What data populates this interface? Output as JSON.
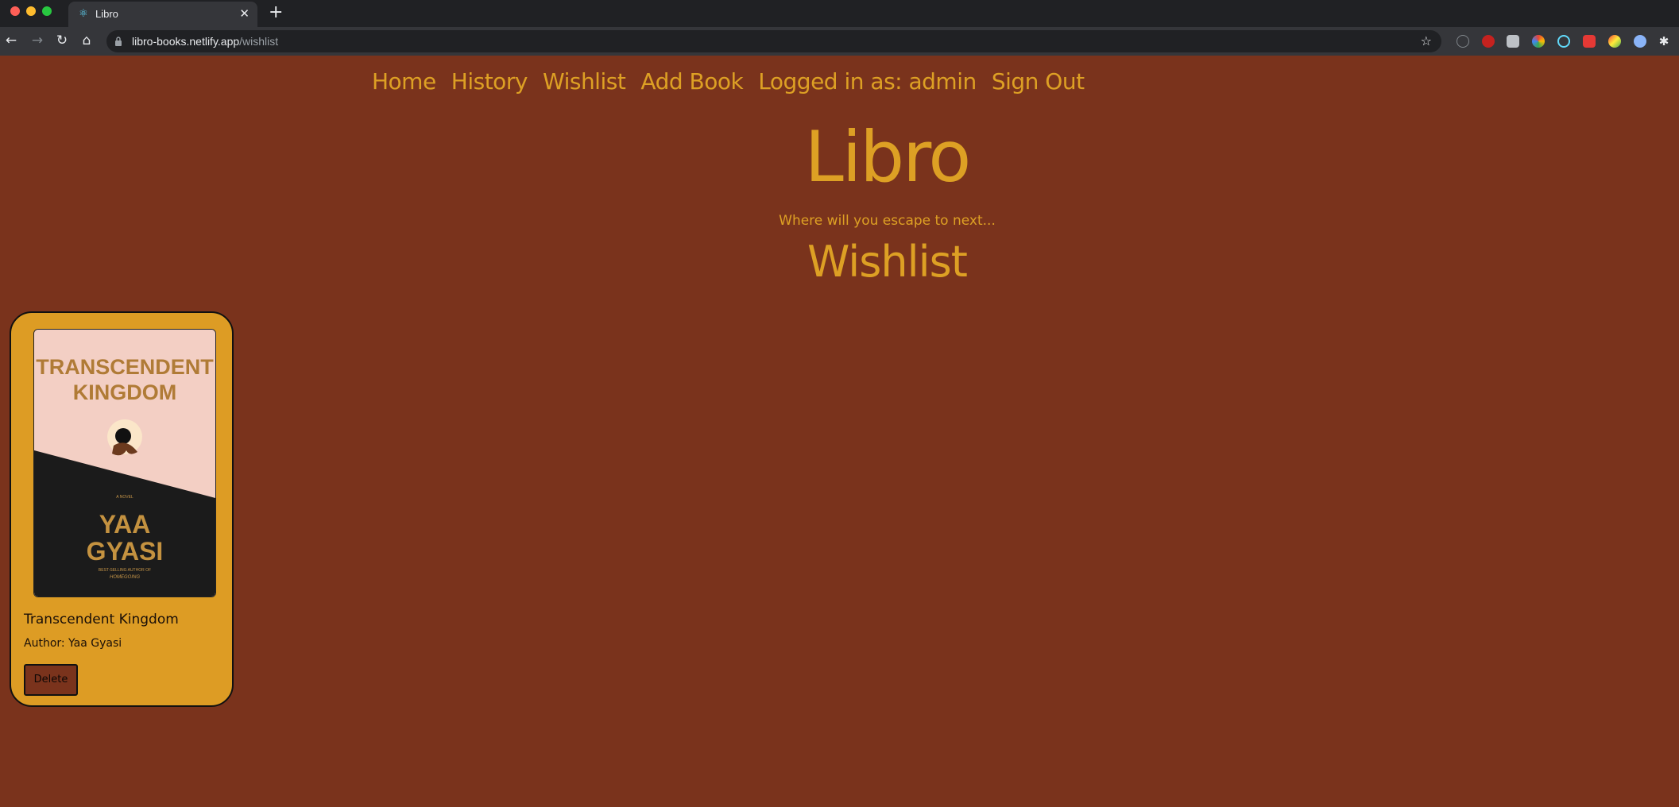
{
  "browser": {
    "tab_title": "Libro",
    "url_domain": "libro-books.netlify.app",
    "url_path": "/wishlist"
  },
  "nav": {
    "home": "Home",
    "history": "History",
    "wishlist": "Wishlist",
    "add_book": "Add Book",
    "logged_in": "Logged in as: admin",
    "sign_out": "Sign Out"
  },
  "header": {
    "title": "Libro",
    "tagline": "Where will you escape to next...",
    "page_heading": "Wishlist"
  },
  "books": [
    {
      "title": "Transcendent Kingdom",
      "author": "Author: Yaa Gyasi",
      "delete_label": "Delete",
      "cover_title_line1": "TRANSCENDENT",
      "cover_title_line2": "KINGDOM",
      "cover_tag": "A NOVEL",
      "cover_author_line1": "YAA",
      "cover_author_line2": "GYASI",
      "cover_blurb": "BEST-SELLING AUTHOR OF",
      "cover_blurb2": "HOMEGOING"
    }
  ],
  "colors": {
    "background": "#7a331c",
    "accent": "#dda024",
    "card": "#dd9c24"
  },
  "icons": {
    "tab_favicon": "react-icon",
    "lock": "lock-icon",
    "bookmark": "star-icon"
  }
}
